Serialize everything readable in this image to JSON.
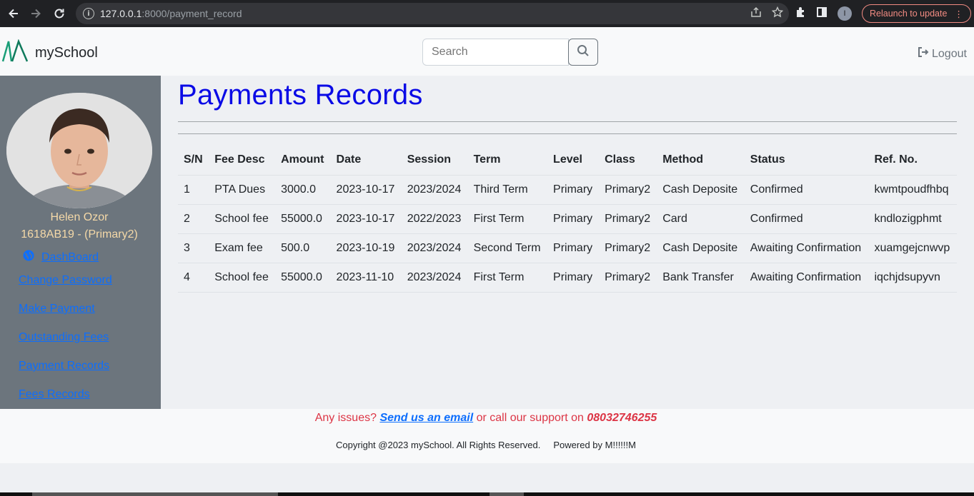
{
  "browser": {
    "url_host": "127.0.0.1",
    "url_rest": ":8000/payment_record",
    "relaunch_label": "Relaunch to update",
    "profile_initial": "I"
  },
  "navbar": {
    "brand": "mySchool",
    "search_placeholder": "Search",
    "logout_label": "Logout"
  },
  "sidebar": {
    "name": "Helen Ozor",
    "id_class": "1618AB19 - (Primary2)",
    "links": [
      "DashBoard",
      "Change Password",
      "Make Payment",
      "Outstanding Fees",
      "Payment Records",
      "Fees Records"
    ]
  },
  "main": {
    "title": "Payments Records",
    "columns": [
      "S/N",
      "Fee Desc",
      "Amount",
      "Date",
      "Session",
      "Term",
      "Level",
      "Class",
      "Method",
      "Status",
      "Ref. No."
    ],
    "rows": [
      [
        "1",
        "PTA Dues",
        "3000.0",
        "2023-10-17",
        "2023/2024",
        "Third Term",
        "Primary",
        "Primary2",
        "Cash Deposite",
        "Confirmed",
        "kwmtpoudfhbq"
      ],
      [
        "2",
        "School fee",
        "55000.0",
        "2023-10-17",
        "2022/2023",
        "First Term",
        "Primary",
        "Primary2",
        "Card",
        "Confirmed",
        "kndlozigphmt"
      ],
      [
        "3",
        "Exam fee",
        "500.0",
        "2023-10-19",
        "2023/2024",
        "Second Term",
        "Primary",
        "Primary2",
        "Cash Deposite",
        "Awaiting Confirmation",
        "xuamgejcnwvp"
      ],
      [
        "4",
        "School fee",
        "55000.0",
        "2023-11-10",
        "2023/2024",
        "First Term",
        "Primary",
        "Primary2",
        "Bank Transfer",
        "Awaiting Confirmation",
        "iqchjdsupyvn"
      ]
    ]
  },
  "footer": {
    "issues_prefix": "Any issues?",
    "email_link": "Send us an email",
    "call_text": "or call our support on",
    "phone": "08032746255",
    "copyright": "Copyright @2023 mySchool. All Rights Reserved.",
    "powered": "Powered by M!!!!!!M"
  },
  "colors": {
    "title": "#0a0ae6",
    "sidebar_bg": "#6c757d",
    "link": "#0d6efd",
    "footer_alert": "#dc3545",
    "profile_text": "#f5d9a8"
  }
}
